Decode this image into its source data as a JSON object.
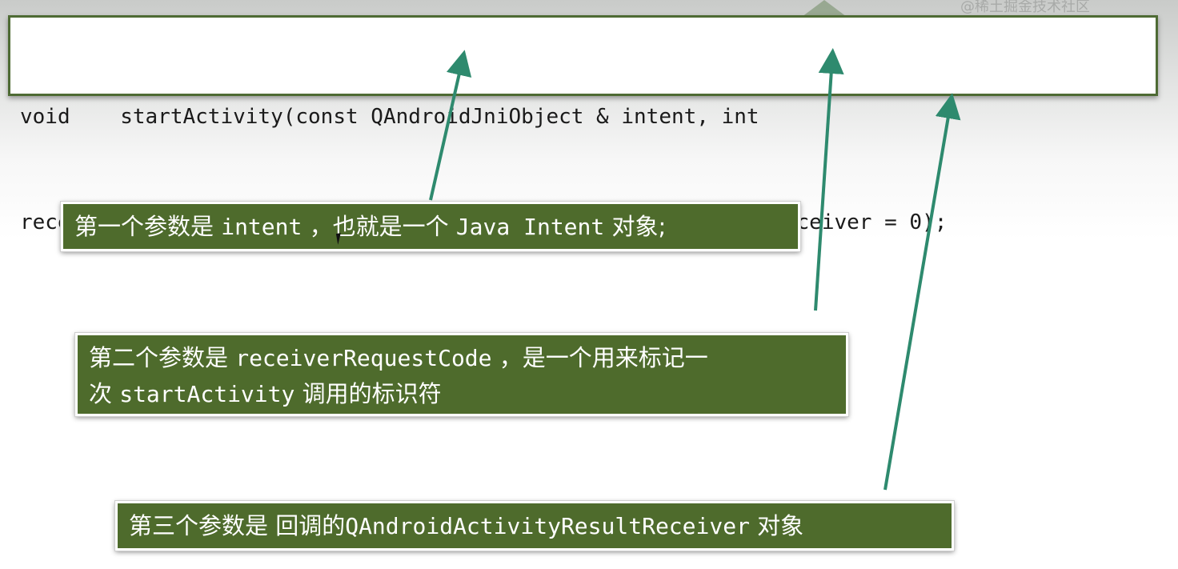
{
  "watermark": "@稀土掘金技术社区",
  "code": {
    "line1": "void    startActivity(const QAndroidJniObject & intent, int",
    "line2": "receiverRequestCode, QAndroidActivityResultReceiver * resultReceiver = 0);"
  },
  "callouts": [
    {
      "prefix": "第一个参数是 ",
      "term": "intent",
      "middle": " ，也就是一个 ",
      "term2": "Java Intent",
      "suffix": " 对象;"
    },
    {
      "prefix": "第二个参数是 ",
      "term": "receiverRequestCode",
      "middle": " ，是一个用来标记一",
      "line2_prefix": "次 ",
      "term2": "startActivity",
      "suffix": " 调用的标识符"
    },
    {
      "prefix": "第三个参数是 回调的",
      "term": "QAndroidActivityResultReceiver",
      "suffix": " 对象"
    }
  ],
  "colors": {
    "callout_bg": "#4e6b2c",
    "arrow": "#2e8a6e",
    "code_border": "#4e6b34"
  }
}
